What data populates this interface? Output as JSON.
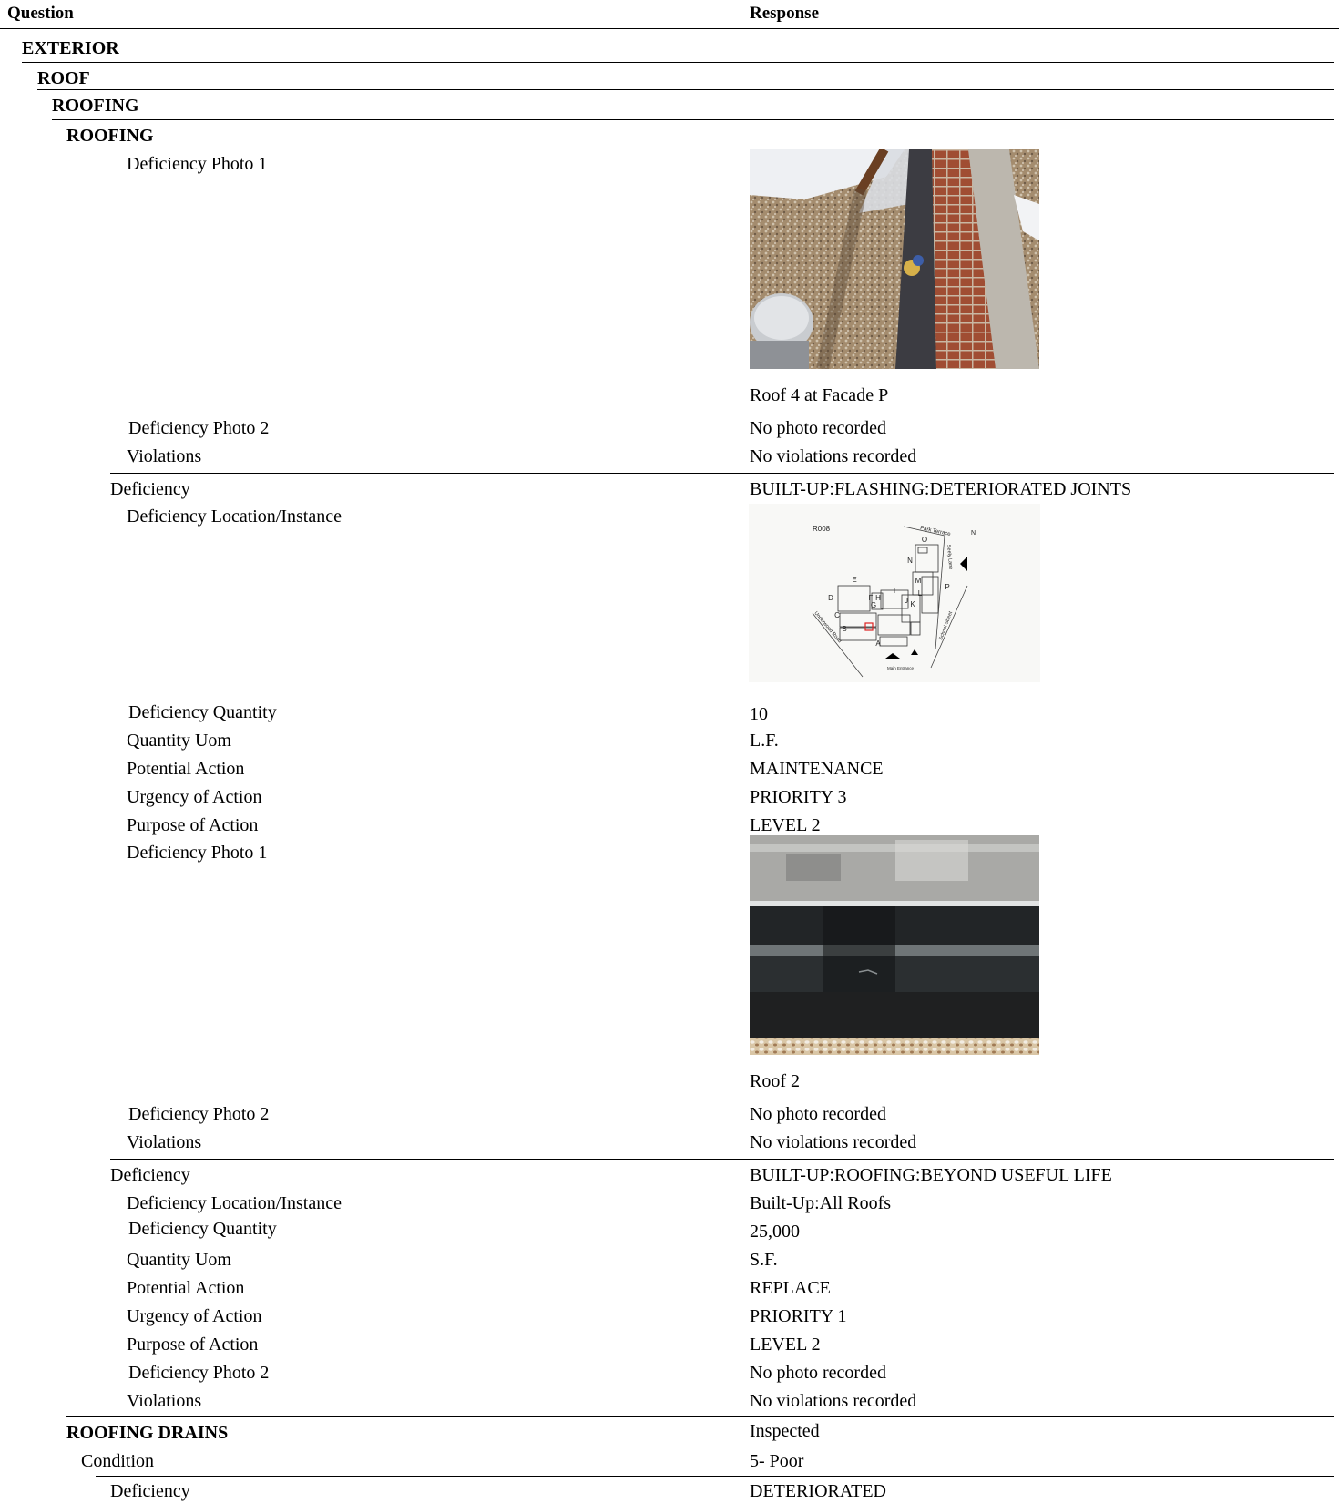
{
  "header": {
    "question": "Question",
    "response": "Response"
  },
  "sections": {
    "exterior": "EXTERIOR",
    "roof": "ROOF",
    "roofing_group": "ROOFING",
    "roofing_item": "ROOFING",
    "roofing_drains": "ROOFING DRAINS",
    "roofing_drains_value": "Inspected"
  },
  "block1": {
    "photo1_label": "Deficiency Photo 1",
    "photo1_caption": "Roof 4 at Facade P",
    "photo2_label": "Deficiency Photo 2",
    "photo2_value": "No photo recorded",
    "violations_label": "Violations",
    "violations_value": "No violations recorded"
  },
  "block2": {
    "deficiency_label": "Deficiency",
    "deficiency_value": "BUILT-UP:FLASHING:DETERIORATED JOINTS",
    "location_label": "Deficiency Location/Instance",
    "map_labels": {
      "code": "R008",
      "street_top": "Park Terrace",
      "north": "N",
      "street_right": "Seely Lane",
      "street_left": "Underwood Road",
      "street_bottom": "School Street",
      "entrance": "Main Entrance",
      "letters": [
        "O",
        "N",
        "M",
        "L",
        "P",
        "E",
        "D",
        "F",
        "H",
        "G",
        "I",
        "J",
        "K",
        "C",
        "B",
        "A"
      ]
    },
    "quantity_label": "Deficiency Quantity",
    "quantity_value": "10",
    "uom_label": "Quantity Uom",
    "uom_value": "L.F.",
    "action_label": "Potential Action",
    "action_value": "MAINTENANCE",
    "urgency_label": "Urgency of Action",
    "urgency_value": "PRIORITY 3",
    "purpose_label": "Purpose of Action",
    "purpose_value": "LEVEL 2",
    "photo1_label": "Deficiency Photo 1",
    "photo1_caption": "Roof 2",
    "photo2_label": "Deficiency Photo 2",
    "photo2_value": "No photo recorded",
    "violations_label": "Violations",
    "violations_value": "No violations recorded"
  },
  "block3": {
    "deficiency_label": "Deficiency",
    "deficiency_value": "BUILT-UP:ROOFING:BEYOND USEFUL LIFE",
    "location_label": "Deficiency Location/Instance",
    "location_value": "Built-Up:All Roofs",
    "quantity_label": "Deficiency Quantity",
    "quantity_value": "25,000",
    "uom_label": "Quantity Uom",
    "uom_value": "S.F.",
    "action_label": "Potential Action",
    "action_value": "REPLACE",
    "urgency_label": "Urgency of Action",
    "urgency_value": "PRIORITY 1",
    "purpose_label": "Purpose of Action",
    "purpose_value": "LEVEL 2",
    "photo2_label": "Deficiency Photo 2",
    "photo2_value": "No photo recorded",
    "violations_label": "Violations",
    "violations_value": "No violations recorded"
  },
  "drains": {
    "condition_label": "Condition",
    "condition_value": "5- Poor",
    "deficiency_label": "Deficiency",
    "deficiency_value": "DETERIORATED"
  }
}
